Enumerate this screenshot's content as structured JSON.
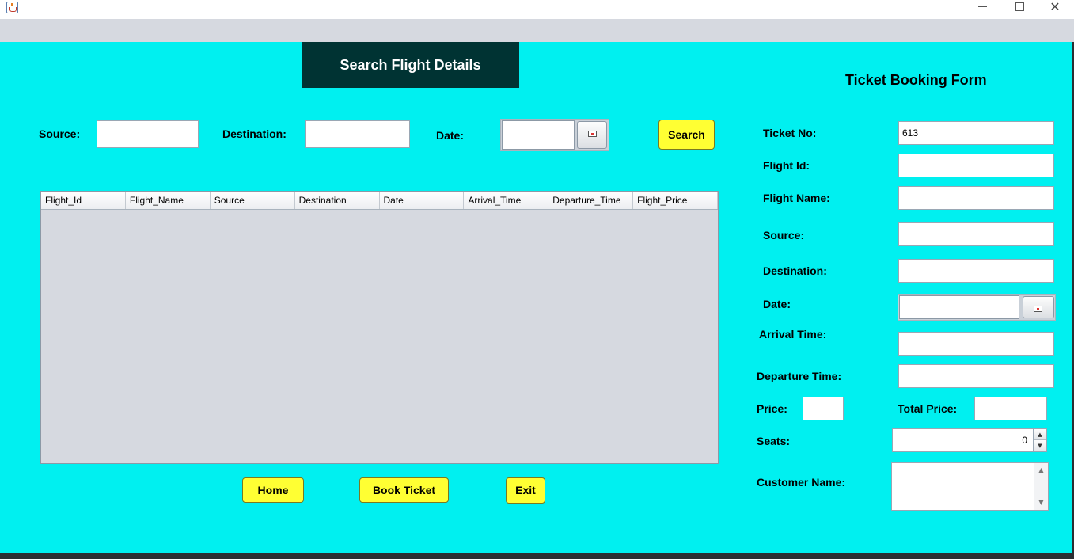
{
  "window": {
    "minimize_icon": "minimize-icon",
    "maximize_icon": "maximize-icon",
    "close_icon": "close-icon",
    "close_glyph": "✕",
    "app_icon": "java-app-icon"
  },
  "search": {
    "heading": "Search Flight Details",
    "source_label": "Source:",
    "source_value": "",
    "destination_label": "Destination:",
    "destination_value": "",
    "date_label": "Date:",
    "date_value": "",
    "search_button": "Search"
  },
  "table": {
    "columns": [
      "Flight_Id",
      "Flight_Name",
      "Source",
      "Destination",
      "Date",
      "Arrival_Time",
      "Departure_Time",
      "Flight_Price"
    ],
    "rows": []
  },
  "actions": {
    "home": "Home",
    "book_ticket": "Book Ticket",
    "exit": "Exit"
  },
  "booking": {
    "title": "Ticket Booking Form",
    "ticket_no_label": "Ticket No:",
    "ticket_no_value": "613",
    "flight_id_label": "Flight Id:",
    "flight_id_value": "",
    "flight_name_label": "Flight Name:",
    "flight_name_value": "",
    "source_label": "Source:",
    "source_value": "",
    "destination_label": "Destination:",
    "destination_value": "",
    "date_label": "Date:",
    "date_value": "",
    "arrival_time_label": "Arrival Time:",
    "arrival_time_value": "",
    "departure_time_label": "Departure Time:",
    "departure_time_value": "",
    "price_label": "Price:",
    "price_value": "",
    "total_price_label": "Total Price:",
    "total_price_value": "",
    "seats_label": "Seats:",
    "seats_value": "0",
    "customer_name_label": "Customer Name:",
    "customer_name_value": ""
  },
  "colors": {
    "panel_bg": "#00f0f0",
    "header_bg": "#003333",
    "button_bg": "#ffff33",
    "menubar_bg": "#d6d9e0"
  }
}
